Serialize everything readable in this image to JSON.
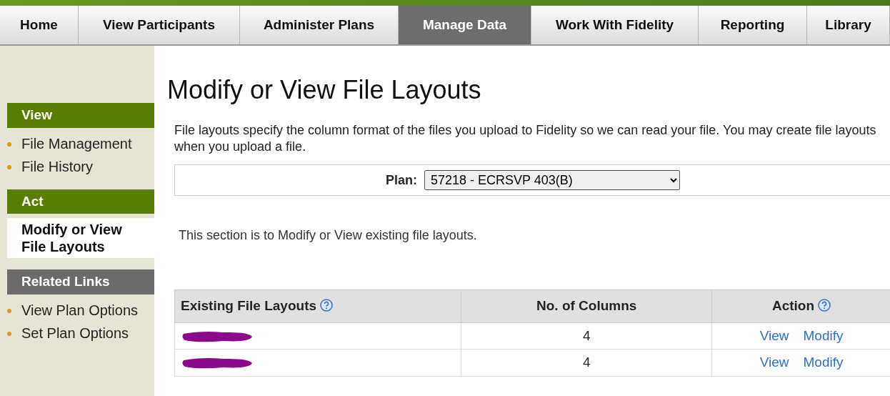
{
  "tabs": [
    {
      "label": "Home",
      "selected": false
    },
    {
      "label": "View Participants",
      "selected": false
    },
    {
      "label": "Administer Plans",
      "selected": false
    },
    {
      "label": "Manage Data",
      "selected": true
    },
    {
      "label": "Work With Fidelity",
      "selected": false
    },
    {
      "label": "Reporting",
      "selected": false
    },
    {
      "label": "Library",
      "selected": false
    }
  ],
  "sidebar": {
    "sections": [
      {
        "title": "View",
        "kind": "green",
        "items": [
          {
            "label": "File Management",
            "selected": false
          },
          {
            "label": "File History",
            "selected": false
          }
        ]
      },
      {
        "title": "Act",
        "kind": "green",
        "items": [
          {
            "label": "Modify or View File Layouts",
            "selected": true
          }
        ]
      },
      {
        "title": "Related Links",
        "kind": "gray",
        "items": [
          {
            "label": "View Plan Options",
            "selected": false
          },
          {
            "label": "Set Plan Options",
            "selected": false
          }
        ]
      }
    ]
  },
  "page_title": "Modify or View File Layouts",
  "intro": "File layouts specify the column format of the files you upload to Fidelity so we can read your file. You may create file layouts when you upload a file.",
  "plan": {
    "label": "Plan:",
    "value": "57218 - ECRSVP 403(B)"
  },
  "section_note": "This section is to Modify or View existing file layouts.",
  "table": {
    "columns": [
      {
        "label": "Existing File Layouts",
        "help": true
      },
      {
        "label": "No. of Columns",
        "help": false
      },
      {
        "label": "Action",
        "help": true
      }
    ],
    "rows": [
      {
        "name_redacted": true,
        "columns": "4",
        "actions": [
          "View",
          "Modify"
        ]
      },
      {
        "name_redacted": true,
        "columns": "4",
        "actions": [
          "View",
          "Modify"
        ]
      }
    ]
  }
}
